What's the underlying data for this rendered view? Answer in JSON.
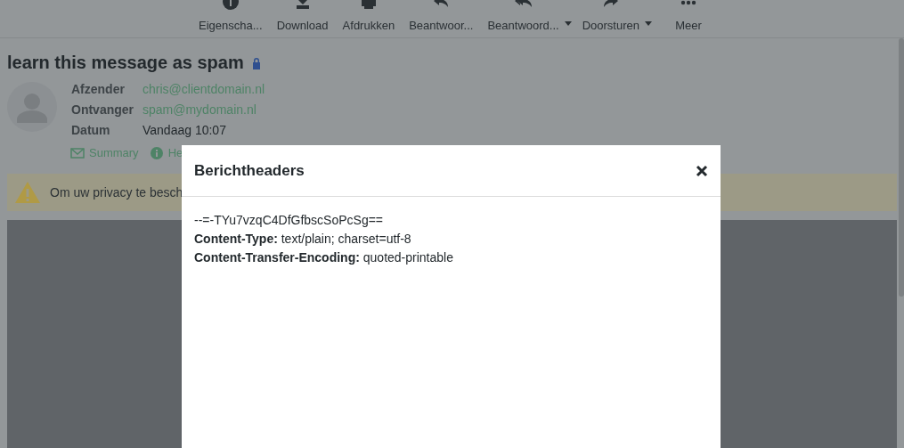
{
  "toolbar": [
    {
      "label": "Eigenscha...",
      "dropdown": false
    },
    {
      "label": "Download",
      "dropdown": false
    },
    {
      "label": "Afdrukken",
      "dropdown": false
    },
    {
      "label": "Beantwoor...",
      "dropdown": false
    },
    {
      "label": "Beantwoord...",
      "dropdown": true
    },
    {
      "label": "Doorsturen",
      "dropdown": true
    },
    {
      "label": "Meer",
      "dropdown": false
    }
  ],
  "message": {
    "subject": "learn this message as spam",
    "headers": [
      {
        "label": "Afzender",
        "value": "chris@clientdomain.nl",
        "kind": "link"
      },
      {
        "label": "Ontvanger",
        "value": "spam@mydomain.nl",
        "kind": "link"
      },
      {
        "label": "Datum",
        "value": "Vandaag 10:07",
        "kind": "text"
      }
    ],
    "links": [
      {
        "label": "Summary"
      },
      {
        "label": "He"
      }
    ],
    "warning": "Om uw privacy te besch"
  },
  "dialog": {
    "title": "Berichtheaders",
    "lines": [
      "--=-TYu7vzqC4DfGfbscSoPcSg==",
      "**Content-Type:** text/plain; charset=utf-8",
      "**Content-Transfer-Encoding:** quoted-printable"
    ]
  }
}
